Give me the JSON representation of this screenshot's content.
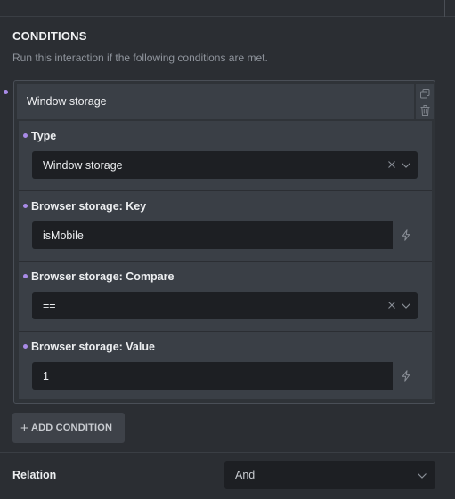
{
  "conditions": {
    "title": "CONDITIONS",
    "description": "Run this interaction if the following conditions are met."
  },
  "condition_card": {
    "header_title": "Window storage",
    "type_field": {
      "label": "Type",
      "value": "Window storage"
    },
    "key_field": {
      "label": "Browser storage: Key",
      "value": "isMobile"
    },
    "compare_field": {
      "label": "Browser storage: Compare",
      "value": "=="
    },
    "value_field": {
      "label": "Browser storage: Value",
      "value": "1"
    }
  },
  "add_condition": {
    "label": "ADD CONDITION",
    "plus": "+"
  },
  "relation": {
    "label": "Relation",
    "value": "And"
  },
  "icons": {
    "copy": "copy-icon",
    "trash": "trash-icon",
    "clear": "x-icon",
    "chevron": "chevron-down-icon",
    "bolt": "bolt-icon"
  },
  "colors": {
    "accent_dot": "#a98be8",
    "panel_bg": "#2b2e33",
    "field_bg": "#3a3f46",
    "input_bg": "#1d1f23"
  }
}
